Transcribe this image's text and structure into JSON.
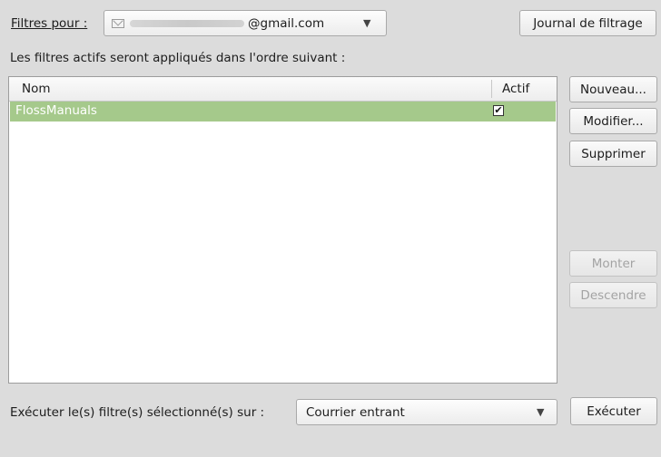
{
  "top": {
    "filters_for_label": "Filtres pour :",
    "account_email_visible": "@gmail.com",
    "account_arrow": "▼",
    "journal_button": "Journal de filtrage"
  },
  "list": {
    "caption": "Les filtres actifs seront appliqués dans l'ordre suivant :",
    "columns": {
      "name": "Nom",
      "active": "Actif"
    },
    "rows": [
      {
        "name": "FlossManuals",
        "active": true,
        "active_mark": "✔"
      }
    ]
  },
  "buttons": {
    "new": "Nouveau...",
    "edit": "Modifier...",
    "delete": "Supprimer",
    "up": "Monter",
    "down": "Descendre",
    "run": "Exécuter"
  },
  "bottom": {
    "run_label": "Exécuter le(s) filtre(s) sélectionné(s) sur :",
    "folder_value": "Courrier entrant",
    "folder_arrow": "▼"
  },
  "colors": {
    "selected_row": "#a5c98b",
    "window_bg": "#dcdcdc"
  }
}
